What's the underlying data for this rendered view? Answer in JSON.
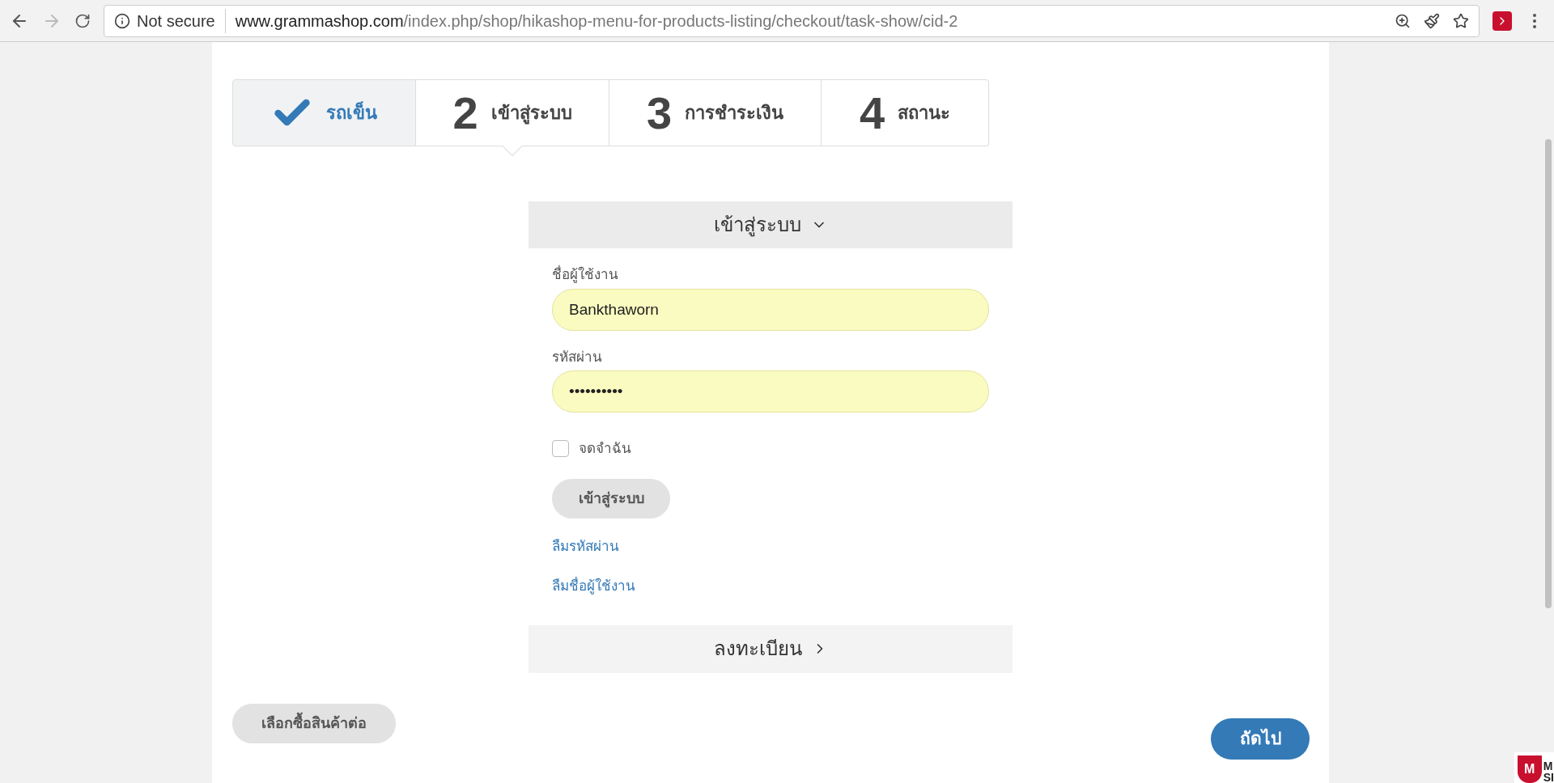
{
  "browser": {
    "security": "Not secure",
    "url_host": "www.grammashop.com",
    "url_path": "/index.php/shop/hikashop-menu-for-products-listing/checkout/task-show/cid-2"
  },
  "steps": [
    {
      "kind": "done",
      "label": "รถเข็น",
      "selected": false
    },
    {
      "kind": "number",
      "number": "2",
      "label": "เข้าสู่ระบบ",
      "selected": true
    },
    {
      "kind": "number",
      "number": "3",
      "label": "การชำระเงิน",
      "selected": false
    },
    {
      "kind": "number",
      "number": "4",
      "label": "สถานะ",
      "selected": false
    }
  ],
  "login": {
    "title": "เข้าสู่ระบบ",
    "expanded": true,
    "username_label": "ชื่อผู้ใช้งาน",
    "username": "Bankthaworn",
    "password_label": "รหัสผ่าน",
    "password": "••••••••••",
    "remember_label": "จดจำฉัน",
    "remember_checked": false,
    "submit": "เข้าสู่ระบบ",
    "links": [
      "ลืมรหัสผ่าน",
      "ลืมชื่อผู้ใช้งาน"
    ]
  },
  "register": {
    "title": "ลงทะเบียน",
    "expanded": false
  },
  "continue_button": "เลือกซื้อสินค้าต่อ",
  "next_button": "ถัดไป",
  "badge": {
    "shield_letter": "M",
    "text_1": "M",
    "text_2": "SI"
  }
}
